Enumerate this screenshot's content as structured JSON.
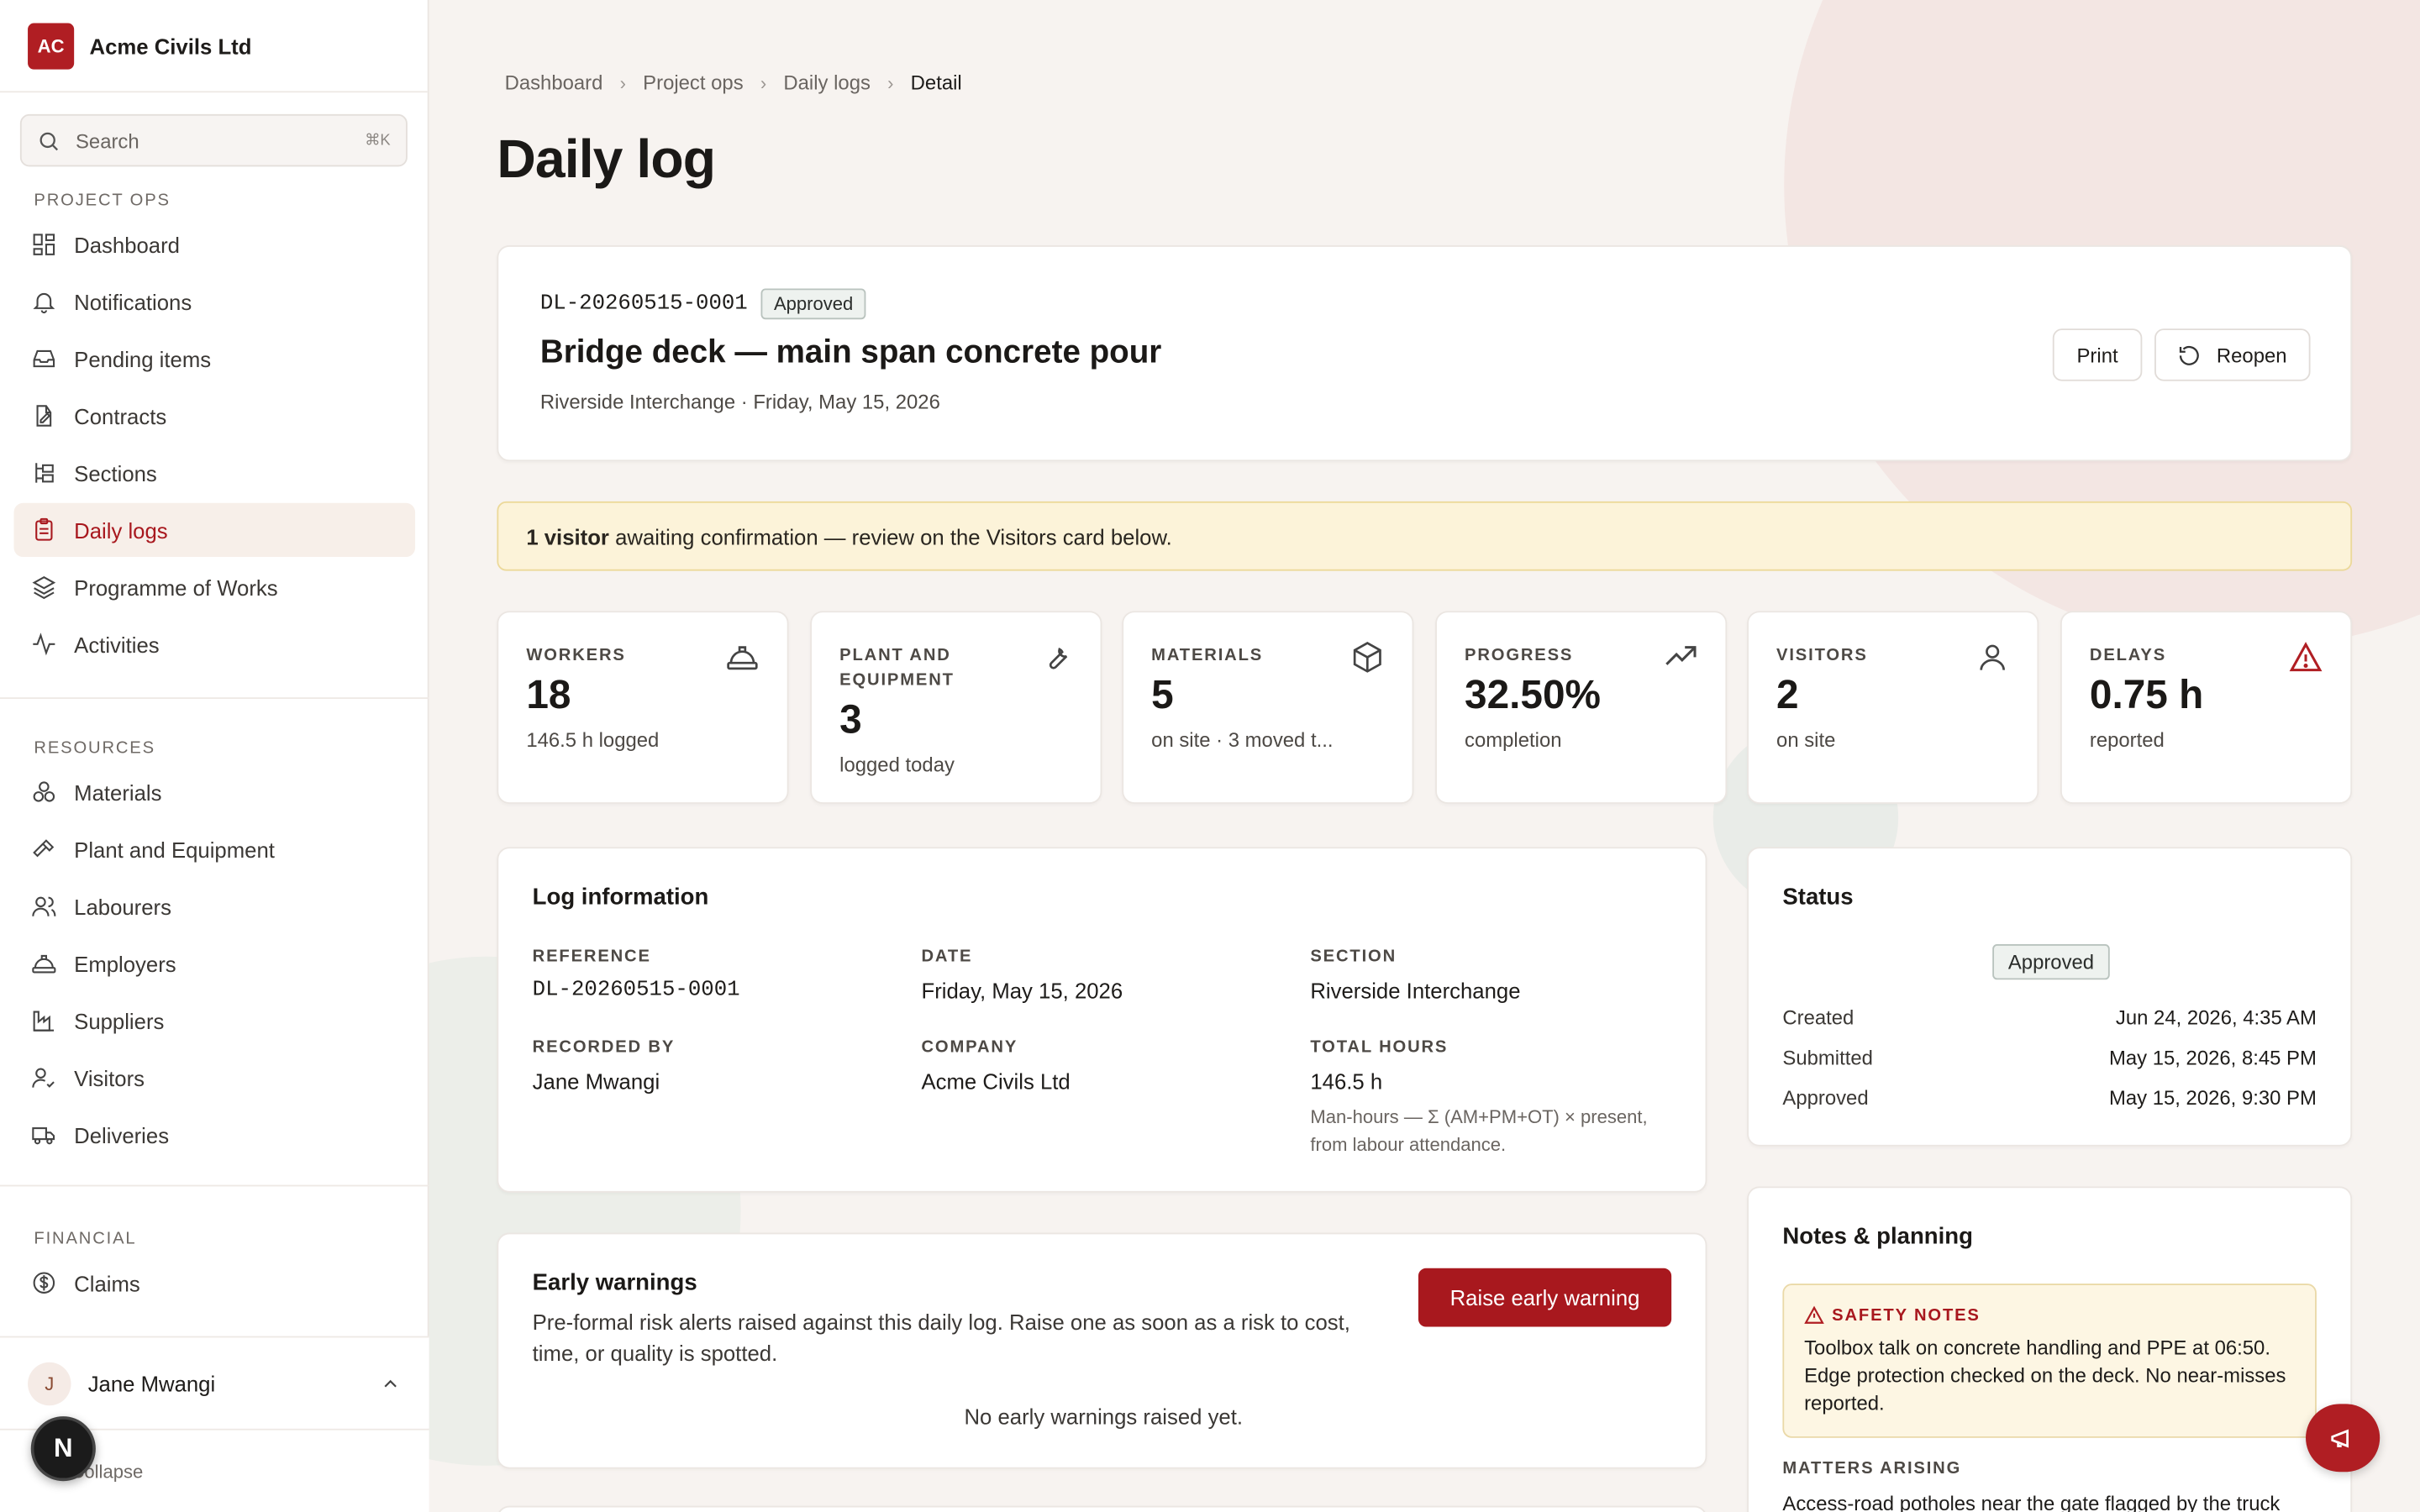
{
  "brand": {
    "initials": "AC",
    "name": "Acme Civils Ltd"
  },
  "search": {
    "placeholder": "Search",
    "shortcut": "⌘K"
  },
  "sidebar": {
    "project_ops_heading": "PROJECT OPS",
    "project_ops": [
      {
        "label": "Dashboard",
        "icon": "dashboard-icon"
      },
      {
        "label": "Notifications",
        "icon": "bell-icon"
      },
      {
        "label": "Pending items",
        "icon": "inbox-icon"
      },
      {
        "label": "Contracts",
        "icon": "contract-icon"
      },
      {
        "label": "Sections",
        "icon": "sections-icon"
      },
      {
        "label": "Daily logs",
        "icon": "clipboard-icon",
        "active": true
      },
      {
        "label": "Programme of Works",
        "icon": "layers-icon"
      },
      {
        "label": "Activities",
        "icon": "activity-icon"
      }
    ],
    "resources_heading": "RESOURCES",
    "resources": [
      {
        "label": "Materials",
        "icon": "materials-icon"
      },
      {
        "label": "Plant and Equipment",
        "icon": "hammer-icon"
      },
      {
        "label": "Labourers",
        "icon": "users-icon"
      },
      {
        "label": "Employers",
        "icon": "hardhat-icon"
      },
      {
        "label": "Suppliers",
        "icon": "factory-icon"
      },
      {
        "label": "Visitors",
        "icon": "user-check-icon"
      },
      {
        "label": "Deliveries",
        "icon": "truck-icon"
      }
    ],
    "financial_heading": "FINANCIAL",
    "financial": [
      {
        "label": "Claims",
        "icon": "dollar-circle-icon"
      }
    ],
    "user": {
      "initial": "J",
      "name": "Jane Mwangi"
    },
    "collapse_label": "Collapse",
    "dev_badge": "N"
  },
  "breadcrumb": [
    "Dashboard",
    "Project ops",
    "Daily logs",
    "Detail"
  ],
  "page_title": "Daily log",
  "header_card": {
    "reference": "DL-20260515-0001",
    "status": "Approved",
    "title": "Bridge deck — main span concrete pour",
    "subtitle": "Riverside Interchange · Friday, May 15, 2026",
    "print_label": "Print",
    "reopen_label": "Reopen"
  },
  "alert": {
    "bold": "1 visitor",
    "text": " awaiting confirmation — review on the Visitors card below."
  },
  "stats": [
    {
      "label": "WORKERS",
      "value": "18",
      "sub": "146.5 h logged",
      "icon": "hardhat-icon"
    },
    {
      "label": "PLANT AND EQUIPMENT",
      "value": "3",
      "sub": "logged today",
      "icon": "wrench-icon"
    },
    {
      "label": "MATERIALS",
      "value": "5",
      "sub": "on site · 3 moved t...",
      "icon": "box-icon"
    },
    {
      "label": "PROGRESS",
      "value": "32.50%",
      "sub": "completion",
      "icon": "trending-up-icon"
    },
    {
      "label": "VISITORS",
      "value": "2",
      "sub": "on site",
      "icon": "user-icon"
    },
    {
      "label": "DELAYS",
      "value": "0.75 h",
      "sub": "reported",
      "icon": "warning-icon"
    }
  ],
  "log_info": {
    "title": "Log information",
    "reference_label": "REFERENCE",
    "reference": "DL-20260515-0001",
    "date_label": "DATE",
    "date": "Friday, May 15, 2026",
    "section_label": "SECTION",
    "section": "Riverside Interchange",
    "recorded_by_label": "RECORDED BY",
    "recorded_by": "Jane Mwangi",
    "company_label": "COMPANY",
    "company": "Acme Civils Ltd",
    "total_hours_label": "TOTAL HOURS",
    "total_hours": "146.5 h",
    "total_hours_note": "Man-hours — Σ (AM+PM+OT) × present, from labour attendance."
  },
  "status_card": {
    "title": "Status",
    "badge": "Approved",
    "rows": [
      {
        "label": "Created",
        "value": "Jun 24, 2026, 4:35 AM"
      },
      {
        "label": "Submitted",
        "value": "May 15, 2026, 8:45 PM"
      },
      {
        "label": "Approved",
        "value": "May 15, 2026, 9:30 PM"
      }
    ]
  },
  "early_warnings": {
    "title": "Early warnings",
    "description": "Pre-formal risk alerts raised against this daily log. Raise one as soon as a risk to cost, time, or quality is spotted.",
    "button": "Raise early warning",
    "empty": "No early warnings raised yet."
  },
  "notes": {
    "title": "Notes & planning",
    "safety_heading": "SAFETY NOTES",
    "safety_text": "Toolbox talk on concrete handling and PPE at 06:50. Edge protection checked on the deck. No near-misses reported.",
    "matters_heading": "MATTERS ARISING",
    "matters_text": "Access-road potholes near the gate flagged by the truck"
  },
  "colors": {
    "accent": "#a8181e",
    "brand": "#b01e23",
    "alert_bg": "#fcf3d9"
  }
}
